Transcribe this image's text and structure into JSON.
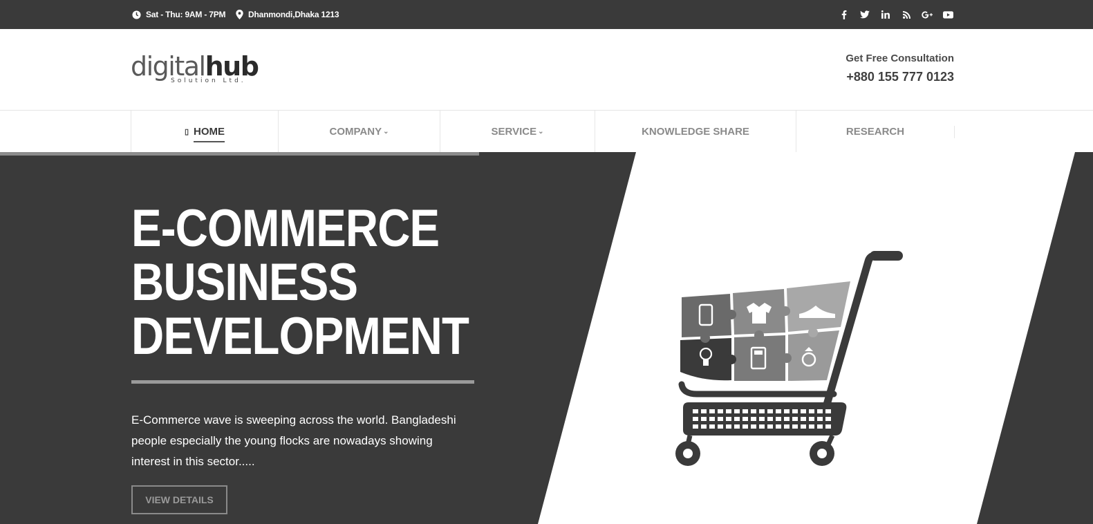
{
  "topbar": {
    "hours": "Sat - Thu: 9AM - 7PM",
    "address": "Dhanmondi,Dhaka 1213",
    "social": [
      {
        "icon": "facebook-icon",
        "glyph": "f"
      },
      {
        "icon": "twitter-icon",
        "glyph": "t"
      },
      {
        "icon": "linkedin-icon",
        "glyph": "in"
      },
      {
        "icon": "rss-icon",
        "glyph": "rss"
      },
      {
        "icon": "google-plus-icon",
        "glyph": "G+"
      },
      {
        "icon": "youtube-icon",
        "glyph": "yt"
      }
    ]
  },
  "header": {
    "logo_digital": "digital",
    "logo_hub": "hub",
    "logo_tagline": "Solution Ltd.",
    "consult_label": "Get Free Consultation",
    "consult_phone": "+880 155 777 0123"
  },
  "nav": {
    "items": [
      {
        "label": "HOME",
        "active": true
      },
      {
        "label": "COMPANY",
        "dropdown": true
      },
      {
        "label": "SERVICE",
        "dropdown": true
      },
      {
        "label": "KNOWLEDGE SHARE"
      },
      {
        "label": "RESEARCH"
      }
    ]
  },
  "hero": {
    "title_line1": "E-COMMERCE",
    "title_line2": "BUSINESS",
    "title_line3": "DEVELOPMENT",
    "description": "E-Commerce wave is sweeping across the world. Bangladeshi people especially the young flocks are nowadays showing interest in this sector.....",
    "button_label": "VIEW DETAILS"
  },
  "colors": {
    "dark": "#3a3a3a",
    "accent_gray": "#8c8c8c",
    "white": "#ffffff"
  }
}
